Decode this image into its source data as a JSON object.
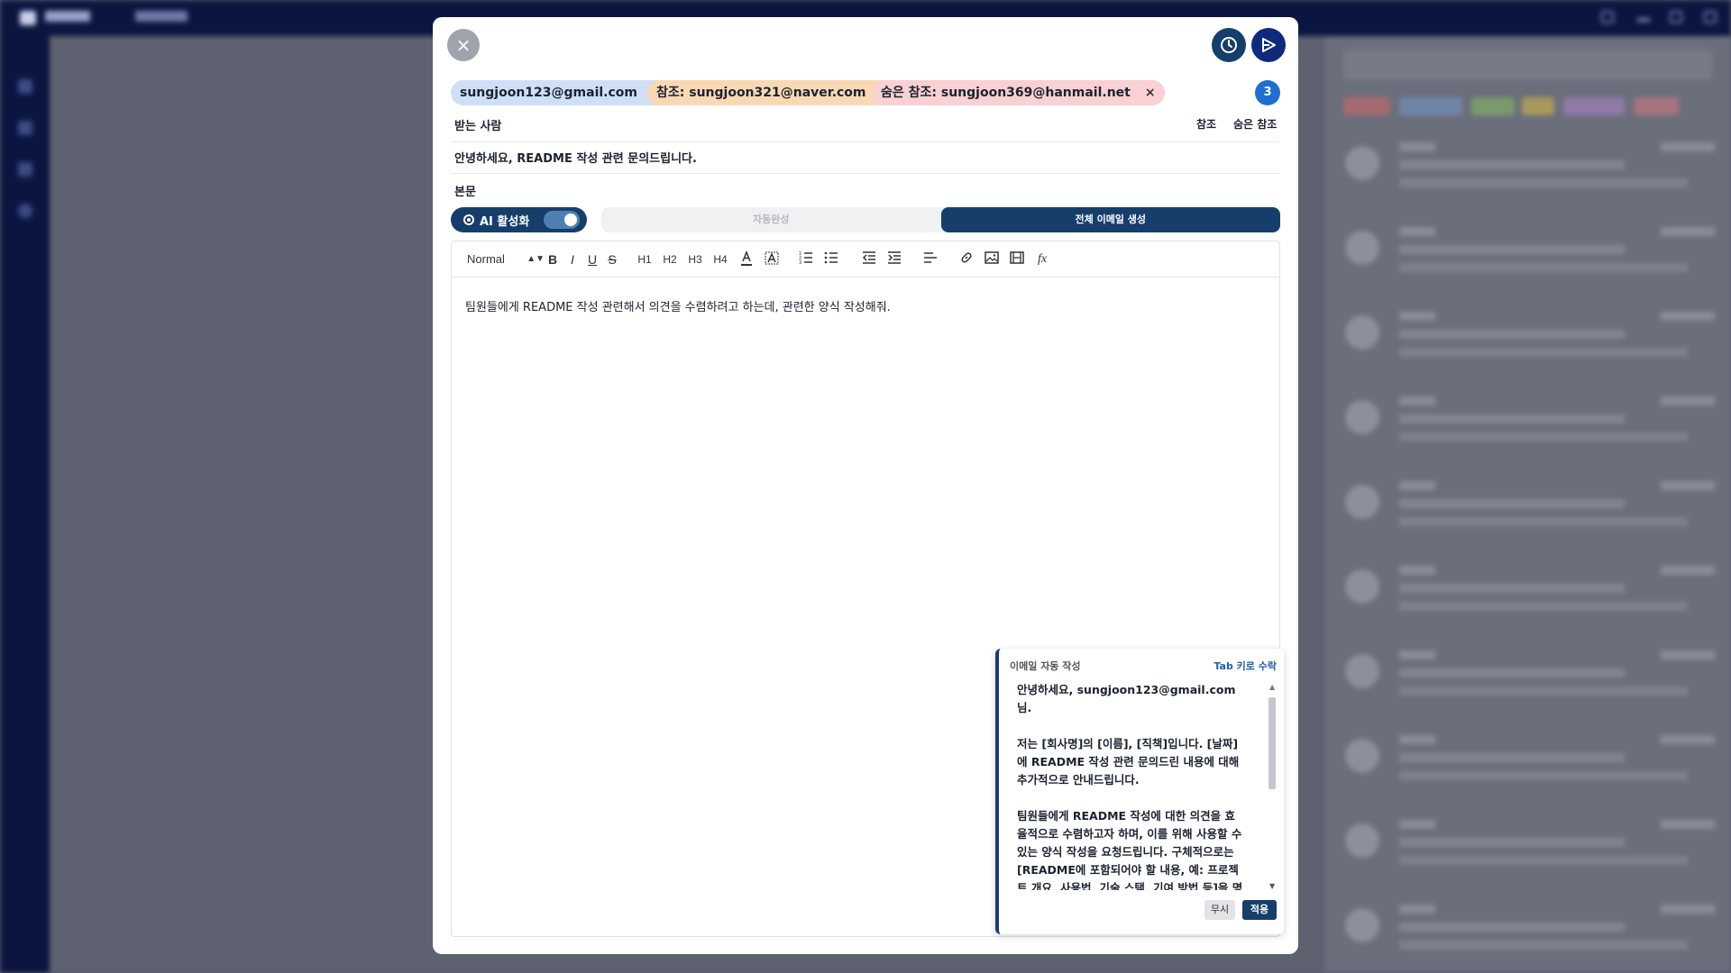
{
  "modal": {
    "close_icon": "×",
    "recipients": {
      "to": "sungjoon123@gmail.com",
      "cc": "참조: sungjoon321@naver.com",
      "bcc": "숨은 참조: sungjoon369@hanmail.net",
      "remove_icon": "×",
      "count": "3"
    },
    "to_label": "받는 사람",
    "cc_link": "참조",
    "bcc_link": "숨은 참조",
    "subject": "안녕하세요, README 작성 관련 문의드립니다.",
    "body_label": "본문",
    "ai_toggle_label": "AI 활성화",
    "modes": {
      "auto": "자동완성",
      "full": "전체 이메일 생성"
    },
    "toolbar": {
      "format_select": "Normal",
      "bold": "B",
      "italic": "I",
      "underline": "U",
      "strike": "S",
      "h1": "H1",
      "h2": "H2",
      "h3": "H3",
      "h4": "H4",
      "formula": "fx"
    },
    "editor_text": "팀원들에게 README 작성 관련해서 의견을 수렴하려고 하는데, 관련한 양식 작성해줘.",
    "suggestion": {
      "title": "이메일 자동 작성",
      "hint": "Tab 키로 수락",
      "paragraphs": [
        "안녕하세요, sungjoon123@gmail.com 님.",
        "저는 [회사명]의 [이름], [직책]입니다. [날짜]에 README 작성 관련 문의드린 내용에 대해 추가적으로 안내드립니다.",
        "팀원들에게 README 작성에 대한 의견을 효율적으로 수렴하고자 하며, 이를 위해 사용할 수 있는 양식 작성을 요청드립니다. 구체적으로는 [README에 포함되어야 할 내용, 예: 프로젝트 개요, 사용법, 기술 스택, 기여 방법 등]을 명확하게 정리하고, 각 항목에 대한 작성 가이드라인을"
      ],
      "ignore": "무시",
      "apply": "적용"
    }
  },
  "colors": {
    "primary": "#163e6b",
    "send": "#0f2a7a",
    "chip_to": "#cfe0f6",
    "chip_cc": "#f8d9b4",
    "chip_bcc": "#f9d0d3",
    "badge": "#1f6fd0"
  },
  "icons": {
    "close": "close-icon",
    "schedule": "clock-icon",
    "send": "send-icon"
  }
}
